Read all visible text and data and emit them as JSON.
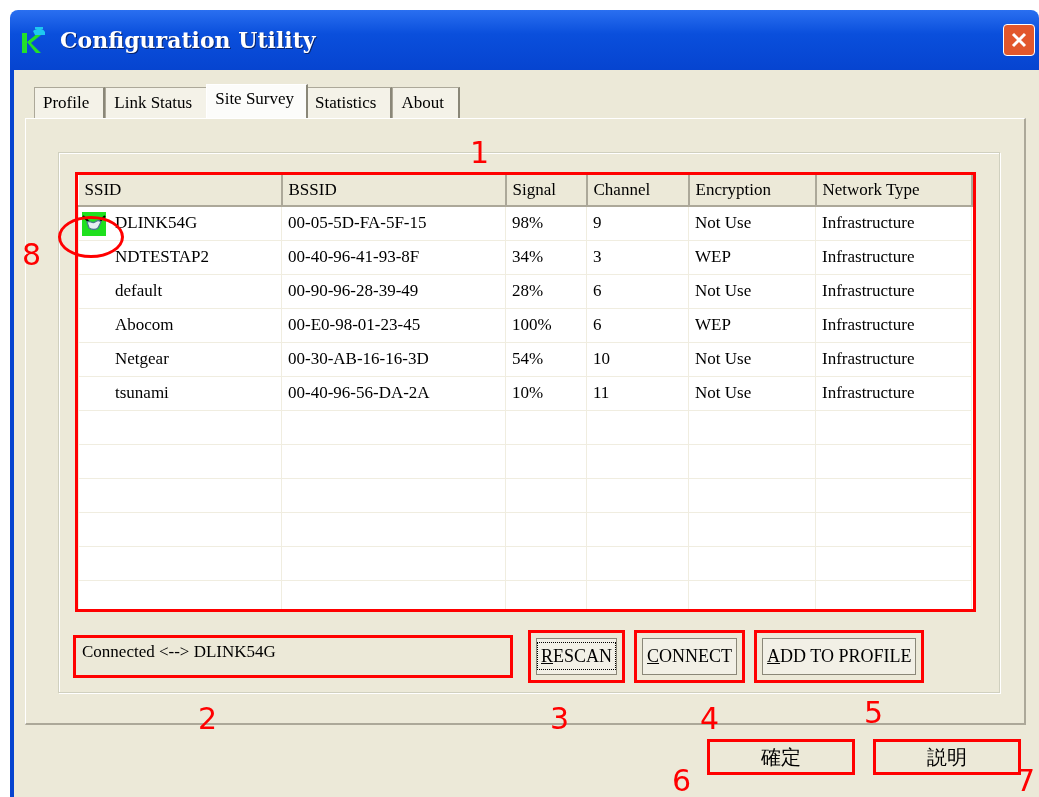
{
  "window": {
    "title": "Configuration Utility"
  },
  "tabs": [
    {
      "label": "Profile",
      "selected": false
    },
    {
      "label": "Link Status",
      "selected": false
    },
    {
      "label": "Site Survey",
      "selected": true
    },
    {
      "label": "Statistics",
      "selected": false
    },
    {
      "label": "About",
      "selected": false
    }
  ],
  "table": {
    "marked": true,
    "columns": [
      "SSID",
      "BSSID",
      "Signal",
      "Channel",
      "Encryption",
      "Network Type"
    ],
    "rows": [
      {
        "connected": true,
        "cells": [
          "DLINK54G",
          "00-05-5D-FA-5F-15",
          "98%",
          "9",
          "Not Use",
          "Infrastructure"
        ]
      },
      {
        "connected": false,
        "cells": [
          "NDTESTAP2",
          "00-40-96-41-93-8F",
          "34%",
          "3",
          "WEP",
          "Infrastructure"
        ]
      },
      {
        "connected": false,
        "cells": [
          "default",
          "00-90-96-28-39-49",
          "28%",
          "6",
          "Not Use",
          "Infrastructure"
        ]
      },
      {
        "connected": false,
        "cells": [
          "Abocom",
          "00-E0-98-01-23-45",
          "100%",
          "6",
          "WEP",
          "Infrastructure"
        ]
      },
      {
        "connected": false,
        "cells": [
          "Netgear",
          "00-30-AB-16-16-3D",
          "54%",
          "10",
          "Not Use",
          "Infrastructure"
        ]
      },
      {
        "connected": false,
        "cells": [
          "tsunami",
          "00-40-96-56-DA-2A",
          "10%",
          "11",
          "Not Use",
          "Infrastructure"
        ]
      }
    ]
  },
  "status": {
    "text": "Connected <--> DLINK54G",
    "marked": true
  },
  "buttons": [
    {
      "label": "RESCAN",
      "underline_first": true,
      "focused": true,
      "marked": true
    },
    {
      "label": "CONNECT",
      "underline_first": true,
      "focused": false,
      "marked": true
    },
    {
      "label": "ADD TO PROFILE",
      "underline_first": true,
      "focused": false,
      "marked": true
    }
  ],
  "dialog_buttons": [
    {
      "label": "確定",
      "marked": true
    },
    {
      "label": "説明",
      "marked": true
    }
  ],
  "annotations": [
    {
      "label": "1"
    },
    {
      "label": "2"
    },
    {
      "label": "3"
    },
    {
      "label": "4"
    },
    {
      "label": "5"
    },
    {
      "label": "6"
    },
    {
      "label": "7"
    },
    {
      "label": "8"
    }
  ]
}
